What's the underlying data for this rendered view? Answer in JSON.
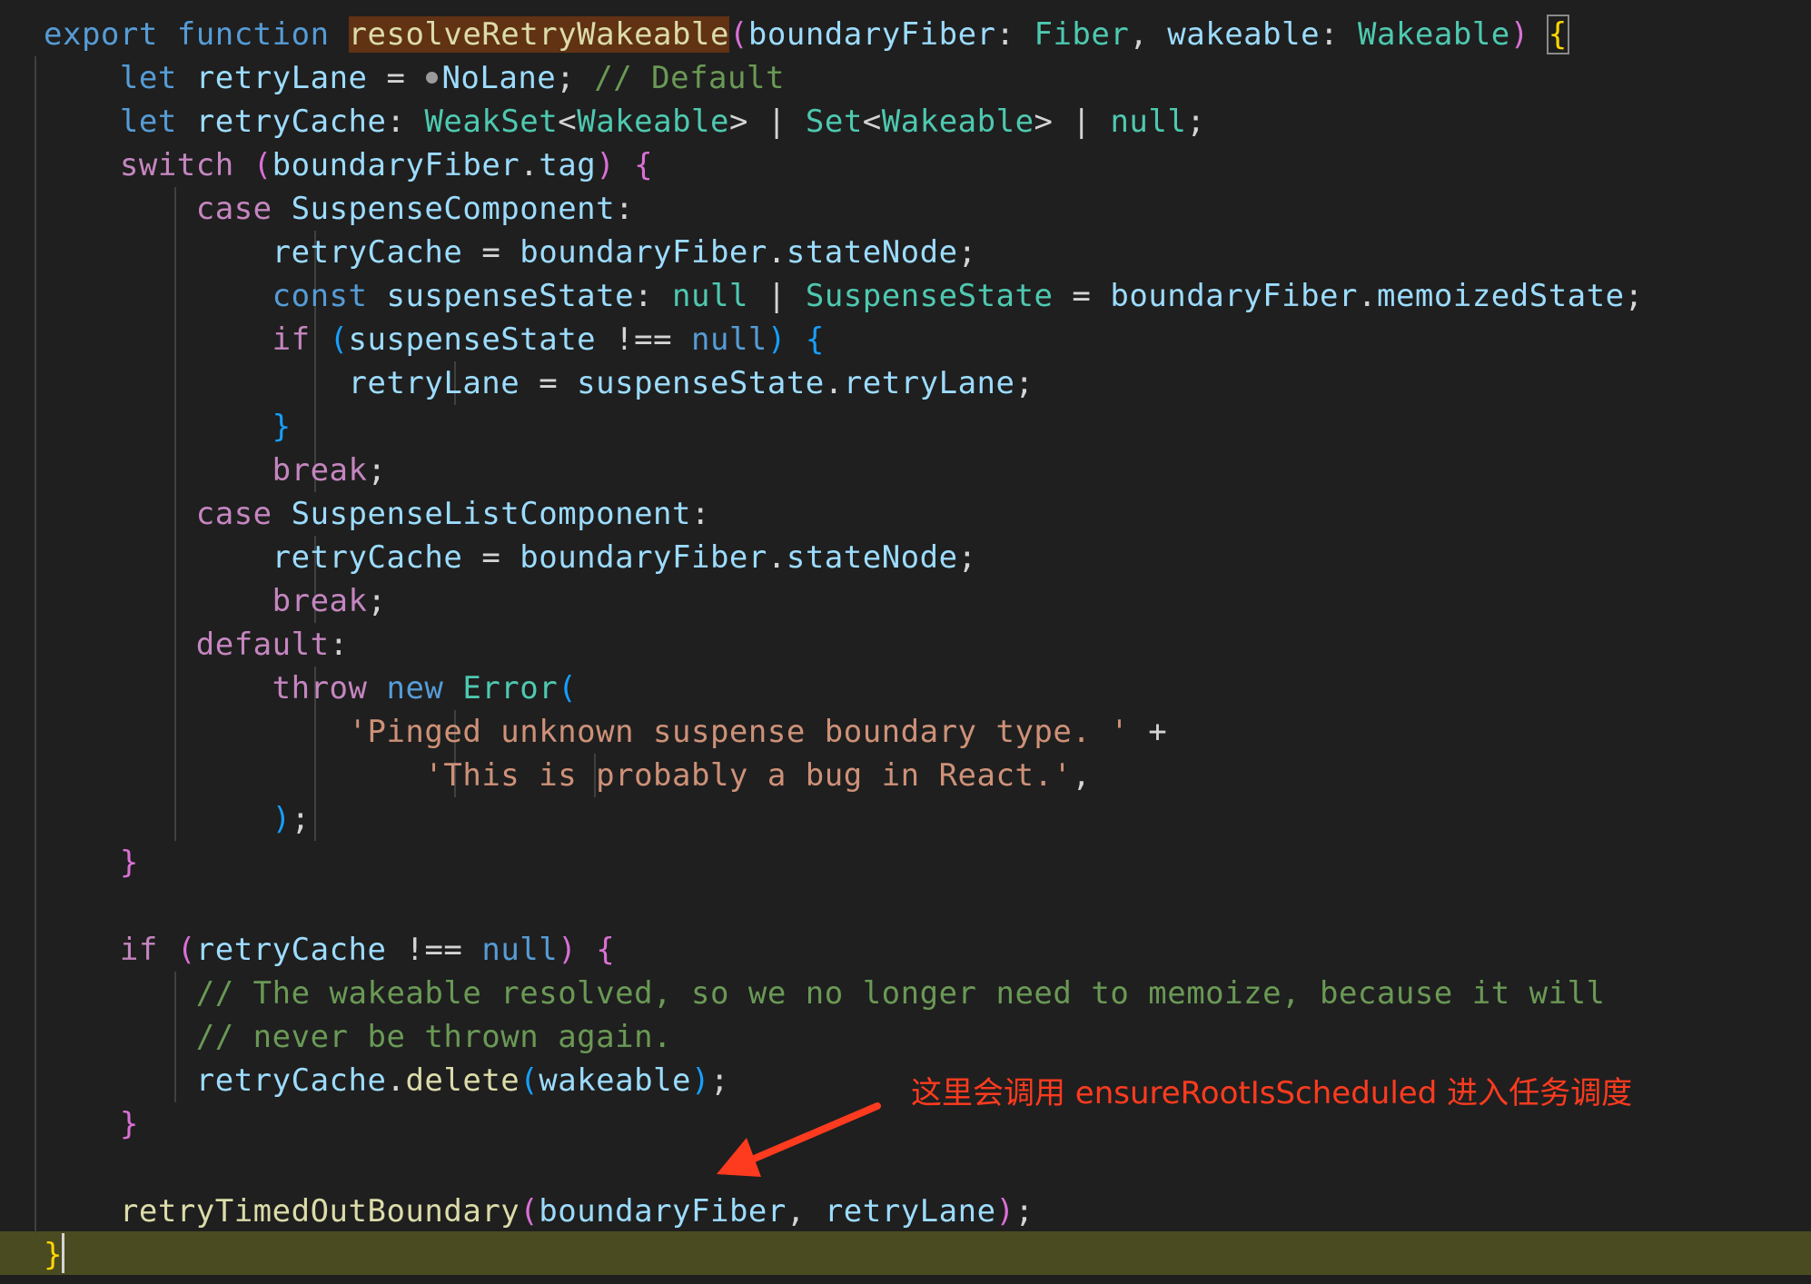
{
  "theme": {
    "background": "#1f1f1f",
    "current_line_highlight": "#4b4b22",
    "function_name_highlight": "#613214",
    "annotation_color": "#ff3b1f",
    "colors": {
      "p": "#d4d4d4",
      "k": "#569cd6",
      "c": "#c586c0",
      "v": "#9cdcfe",
      "t": "#4ec9b0",
      "f": "#dcdcaa",
      "s": "#ce9178",
      "m": "#6a9955",
      "y": "#ffd700",
      "g": "#da70d6",
      "b": "#179fff"
    }
  },
  "annotation": {
    "text": "这里会调用 ensureRootIsScheduled 进入任务调度"
  },
  "code_lines": [
    {
      "guides": [],
      "tokens": [
        [
          "export ",
          "k"
        ],
        [
          "function ",
          "k"
        ],
        [
          "resolveRetryWakeable",
          "f",
          "fnhl"
        ],
        [
          "(",
          "g"
        ],
        [
          "boundaryFiber",
          "v"
        ],
        [
          ": ",
          "p"
        ],
        [
          "Fiber",
          "t"
        ],
        [
          ", ",
          "p"
        ],
        [
          "wakeable",
          "v"
        ],
        [
          ": ",
          "p"
        ],
        [
          "Wakeable",
          "t"
        ],
        [
          ") ",
          "g"
        ],
        [
          "{",
          "y",
          "bracket"
        ]
      ]
    },
    {
      "guides": [
        0
      ],
      "tokens": [
        [
          "    ",
          "p"
        ],
        [
          "let ",
          "k"
        ],
        [
          "retryLane",
          "v"
        ],
        [
          " = ",
          "p"
        ],
        [
          "",
          "p",
          "dot"
        ],
        [
          "NoLane",
          "v"
        ],
        [
          "; ",
          "p"
        ],
        [
          "// Default",
          "m"
        ]
      ]
    },
    {
      "guides": [
        0
      ],
      "tokens": [
        [
          "    ",
          "p"
        ],
        [
          "let ",
          "k"
        ],
        [
          "retryCache",
          "v"
        ],
        [
          ": ",
          "p"
        ],
        [
          "WeakSet",
          "t"
        ],
        [
          "<",
          "p"
        ],
        [
          "Wakeable",
          "t"
        ],
        [
          "> | ",
          "p"
        ],
        [
          "Set",
          "t"
        ],
        [
          "<",
          "p"
        ],
        [
          "Wakeable",
          "t"
        ],
        [
          "> | ",
          "p"
        ],
        [
          "null",
          "t"
        ],
        [
          ";",
          "p"
        ]
      ]
    },
    {
      "guides": [
        0
      ],
      "tokens": [
        [
          "    ",
          "p"
        ],
        [
          "switch ",
          "c"
        ],
        [
          "(",
          "g"
        ],
        [
          "boundaryFiber",
          "v"
        ],
        [
          ".",
          "p"
        ],
        [
          "tag",
          "v"
        ],
        [
          ") ",
          "g"
        ],
        [
          "{",
          "g"
        ]
      ]
    },
    {
      "guides": [
        0,
        4
      ],
      "tokens": [
        [
          "        ",
          "p"
        ],
        [
          "case ",
          "c"
        ],
        [
          "SuspenseComponent",
          "v"
        ],
        [
          ":",
          "p"
        ]
      ]
    },
    {
      "guides": [
        0,
        4,
        8
      ],
      "tokens": [
        [
          "            ",
          "p"
        ],
        [
          "retryCache",
          "v"
        ],
        [
          " = ",
          "p"
        ],
        [
          "boundaryFiber",
          "v"
        ],
        [
          ".",
          "p"
        ],
        [
          "stateNode",
          "v"
        ],
        [
          ";",
          "p"
        ]
      ]
    },
    {
      "guides": [
        0,
        4,
        8
      ],
      "tokens": [
        [
          "            ",
          "p"
        ],
        [
          "const ",
          "k"
        ],
        [
          "suspenseState",
          "v"
        ],
        [
          ": ",
          "p"
        ],
        [
          "null",
          "t"
        ],
        [
          " | ",
          "p"
        ],
        [
          "SuspenseState",
          "t"
        ],
        [
          " = ",
          "p"
        ],
        [
          "boundaryFiber",
          "v"
        ],
        [
          ".",
          "p"
        ],
        [
          "memoizedState",
          "v"
        ],
        [
          ";",
          "p"
        ]
      ]
    },
    {
      "guides": [
        0,
        4,
        8
      ],
      "tokens": [
        [
          "            ",
          "p"
        ],
        [
          "if ",
          "c"
        ],
        [
          "(",
          "b"
        ],
        [
          "suspenseState",
          "v"
        ],
        [
          " !== ",
          "p"
        ],
        [
          "null",
          "k"
        ],
        [
          ") ",
          "b"
        ],
        [
          "{",
          "b"
        ]
      ]
    },
    {
      "guides": [
        0,
        4,
        8,
        12
      ],
      "tokens": [
        [
          "                ",
          "p"
        ],
        [
          "retryLane",
          "v"
        ],
        [
          " = ",
          "p"
        ],
        [
          "suspenseState",
          "v"
        ],
        [
          ".",
          "p"
        ],
        [
          "retryLane",
          "v"
        ],
        [
          ";",
          "p"
        ]
      ]
    },
    {
      "guides": [
        0,
        4,
        8
      ],
      "tokens": [
        [
          "            ",
          "p"
        ],
        [
          "}",
          "b"
        ]
      ]
    },
    {
      "guides": [
        0,
        4,
        8
      ],
      "tokens": [
        [
          "            ",
          "p"
        ],
        [
          "break",
          "c"
        ],
        [
          ";",
          "p"
        ]
      ]
    },
    {
      "guides": [
        0,
        4
      ],
      "tokens": [
        [
          "        ",
          "p"
        ],
        [
          "case ",
          "c"
        ],
        [
          "SuspenseListComponent",
          "v"
        ],
        [
          ":",
          "p"
        ]
      ]
    },
    {
      "guides": [
        0,
        4,
        8
      ],
      "tokens": [
        [
          "            ",
          "p"
        ],
        [
          "retryCache",
          "v"
        ],
        [
          " = ",
          "p"
        ],
        [
          "boundaryFiber",
          "v"
        ],
        [
          ".",
          "p"
        ],
        [
          "stateNode",
          "v"
        ],
        [
          ";",
          "p"
        ]
      ]
    },
    {
      "guides": [
        0,
        4,
        8
      ],
      "tokens": [
        [
          "            ",
          "p"
        ],
        [
          "break",
          "c"
        ],
        [
          ";",
          "p"
        ]
      ]
    },
    {
      "guides": [
        0,
        4
      ],
      "tokens": [
        [
          "        ",
          "p"
        ],
        [
          "default",
          "c"
        ],
        [
          ":",
          "p"
        ]
      ]
    },
    {
      "guides": [
        0,
        4,
        8
      ],
      "tokens": [
        [
          "            ",
          "p"
        ],
        [
          "throw ",
          "c"
        ],
        [
          "new ",
          "k"
        ],
        [
          "Error",
          "t"
        ],
        [
          "(",
          "b"
        ]
      ]
    },
    {
      "guides": [
        0,
        4,
        8,
        12
      ],
      "tokens": [
        [
          "                ",
          "p"
        ],
        [
          "'Pinged unknown suspense boundary type. '",
          "s"
        ],
        [
          " +",
          "p"
        ]
      ]
    },
    {
      "guides": [
        0,
        4,
        8,
        12,
        16
      ],
      "tokens": [
        [
          "                    ",
          "p"
        ],
        [
          "'This is probably a bug in React.'",
          "s"
        ],
        [
          ",",
          "p"
        ]
      ]
    },
    {
      "guides": [
        0,
        4,
        8
      ],
      "tokens": [
        [
          "            ",
          "p"
        ],
        [
          ")",
          "b"
        ],
        [
          ";",
          "p"
        ]
      ]
    },
    {
      "guides": [
        0
      ],
      "tokens": [
        [
          "    ",
          "p"
        ],
        [
          "}",
          "g"
        ]
      ]
    },
    {
      "guides": [
        0
      ],
      "tokens": [
        [
          "",
          "p"
        ]
      ]
    },
    {
      "guides": [
        0
      ],
      "tokens": [
        [
          "    ",
          "p"
        ],
        [
          "if ",
          "c"
        ],
        [
          "(",
          "g"
        ],
        [
          "retryCache",
          "v"
        ],
        [
          " !== ",
          "p"
        ],
        [
          "null",
          "k"
        ],
        [
          ") ",
          "g"
        ],
        [
          "{",
          "g"
        ]
      ]
    },
    {
      "guides": [
        0,
        4
      ],
      "tokens": [
        [
          "        ",
          "p"
        ],
        [
          "// The wakeable resolved, so we no longer need to memoize, because it will",
          "m"
        ]
      ]
    },
    {
      "guides": [
        0,
        4
      ],
      "tokens": [
        [
          "        ",
          "p"
        ],
        [
          "// never be thrown again.",
          "m"
        ]
      ]
    },
    {
      "guides": [
        0,
        4
      ],
      "tokens": [
        [
          "        ",
          "p"
        ],
        [
          "retryCache",
          "v"
        ],
        [
          ".",
          "p"
        ],
        [
          "delete",
          "f"
        ],
        [
          "(",
          "b"
        ],
        [
          "wakeable",
          "v"
        ],
        [
          ")",
          "b"
        ],
        [
          ";",
          "p"
        ]
      ]
    },
    {
      "guides": [
        0
      ],
      "tokens": [
        [
          "    ",
          "p"
        ],
        [
          "}",
          "g"
        ]
      ]
    },
    {
      "guides": [
        0
      ],
      "tokens": [
        [
          "",
          "p"
        ]
      ]
    },
    {
      "guides": [
        0
      ],
      "tokens": [
        [
          "    ",
          "p"
        ],
        [
          "retryTimedOutBoundary",
          "f"
        ],
        [
          "(",
          "g"
        ],
        [
          "boundaryFiber",
          "v"
        ],
        [
          ", ",
          "p"
        ],
        [
          "retryLane",
          "v"
        ],
        [
          ")",
          "g"
        ],
        [
          ";",
          "p"
        ]
      ]
    },
    {
      "guides": [],
      "tokens": [
        [
          "}",
          "y"
        ]
      ]
    }
  ]
}
